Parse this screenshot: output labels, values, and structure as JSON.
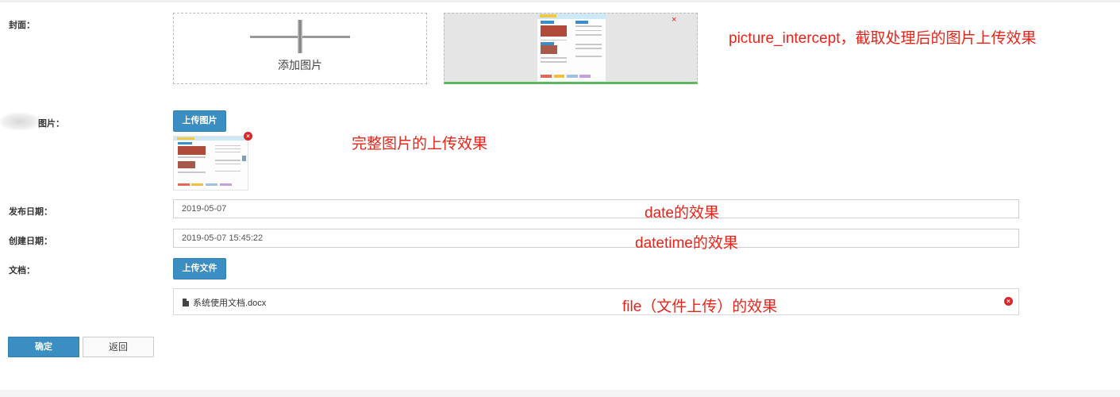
{
  "labels": {
    "cover": "封面：",
    "image": "图片：",
    "publish_date": "发布日期：",
    "create_date": "创建日期：",
    "document": "文档："
  },
  "cover": {
    "add_image_text": "添加图片",
    "close_symbol": "×"
  },
  "image": {
    "upload_button": "上传图片",
    "close_symbol": "×"
  },
  "fields": {
    "publish_date_value": "2019-05-07",
    "create_date_value": "2019-05-07 15:45:22"
  },
  "document": {
    "upload_button": "上传文件",
    "file_name": "系统使用文档.docx",
    "close_symbol": "×"
  },
  "annotations": {
    "picture_intercept": "picture_intercept，截取处理后的图片上传效果",
    "full_image": "完整图片的上传效果",
    "date": "date的效果",
    "datetime": "datetime的效果",
    "file": "file（文件上传）的效果"
  },
  "actions": {
    "confirm": "确定",
    "back": "返回"
  },
  "colors": {
    "primary": "#3a8ec2",
    "annotation": "#e8241a",
    "danger": "#d9262c",
    "success_border": "#5cb85c"
  }
}
